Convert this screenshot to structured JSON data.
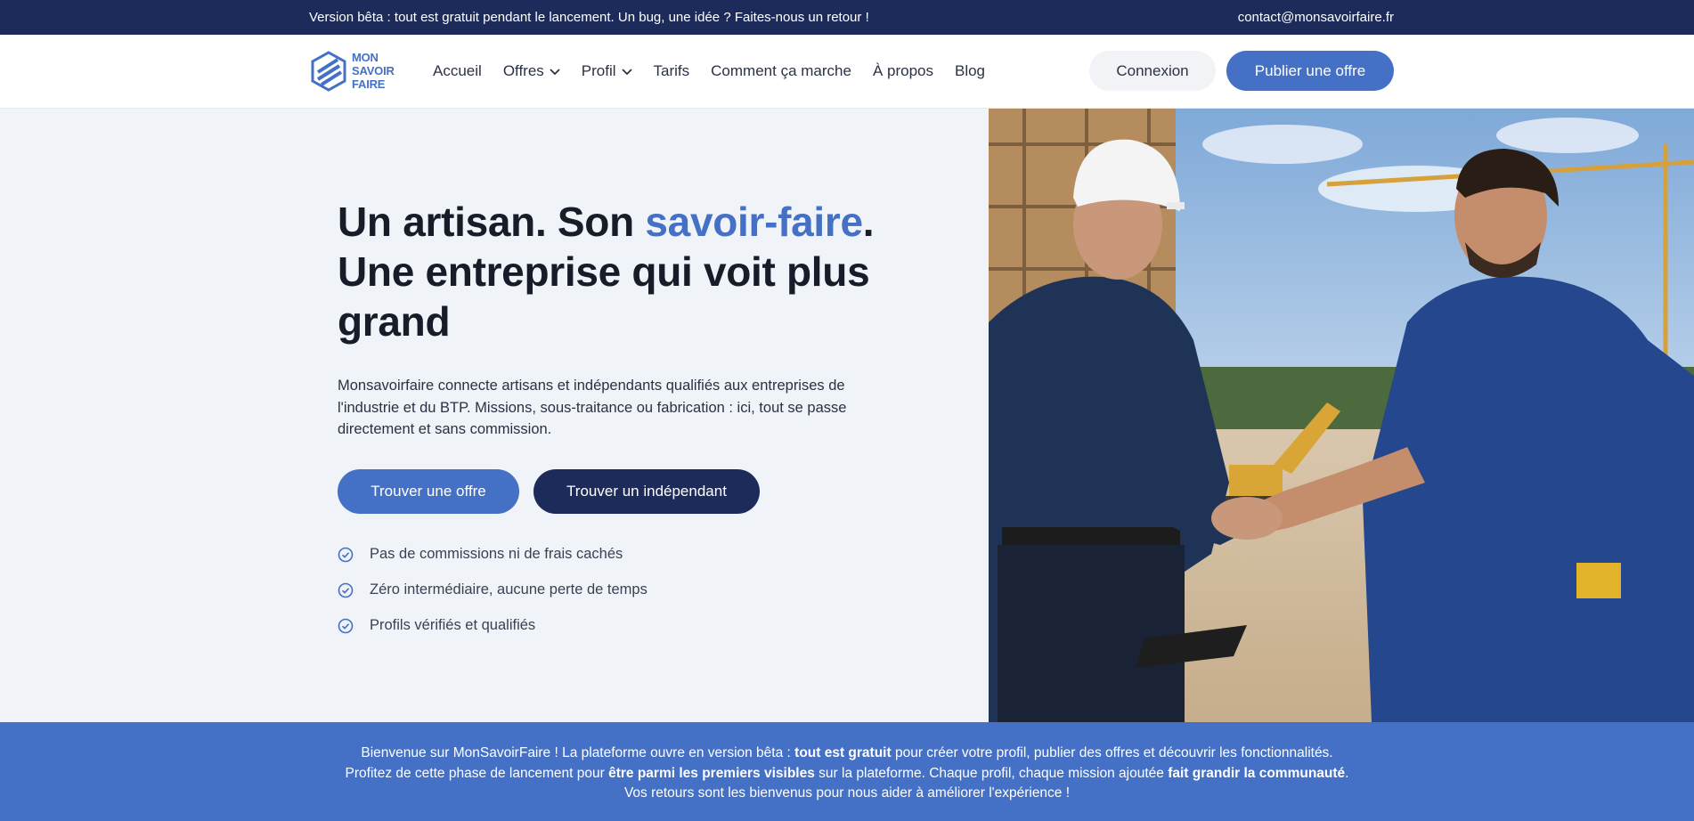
{
  "topbar": {
    "message": "Version bêta : tout est gratuit pendant le lancement. Un bug, une idée ? Faites-nous un retour !",
    "email": "contact@monsavoirfaire.fr"
  },
  "logo": {
    "line1": "MON",
    "line2": "SAVOIR",
    "line3": "FAIRE"
  },
  "nav": {
    "items": [
      {
        "label": "Accueil",
        "dropdown": false
      },
      {
        "label": "Offres",
        "dropdown": true
      },
      {
        "label": "Profil",
        "dropdown": true
      },
      {
        "label": "Tarifs",
        "dropdown": false
      },
      {
        "label": "Comment ça marche",
        "dropdown": false
      },
      {
        "label": "À propos",
        "dropdown": false
      },
      {
        "label": "Blog",
        "dropdown": false
      }
    ],
    "login_label": "Connexion",
    "publish_label": "Publier une offre"
  },
  "hero": {
    "title_part1": "Un artisan. Son ",
    "title_accent": "savoir-faire",
    "title_part2": ".",
    "title_line2": "Une entreprise qui voit plus",
    "title_line3": "grand",
    "description": "Monsavoirfaire connecte artisans et indépendants qualifiés aux entreprises de l'industrie et du BTP. Missions, sous-traitance ou fabrication : ici, tout se passe directement et sans commission.",
    "cta_offer": "Trouver une offre",
    "cta_indep": "Trouver un indépendant",
    "checks": [
      "Pas de commissions ni de frais cachés",
      "Zéro intermédiaire, aucune perte de temps",
      "Profils vérifiés et qualifiés"
    ]
  },
  "banner": {
    "l1a": "Bienvenue sur MonSavoirFaire ! La plateforme ouvre en version bêta : ",
    "l1b": "tout est gratuit",
    "l1c": " pour créer votre profil, publier des offres et découvrir les fonctionnalités.",
    "l2a": "Profitez de cette phase de lancement pour ",
    "l2b": "être parmi les premiers visibles",
    "l2c": " sur la plateforme. Chaque profil, chaque mission ajoutée ",
    "l2d": "fait grandir la communauté",
    "l2e": ".",
    "l3": "Vos retours sont les bienvenus pour nous aider à améliorer l'expérience !"
  },
  "colors": {
    "brand": "#4470c5",
    "navy": "#1c2b5a",
    "hero_bg": "#f0f3f8"
  }
}
